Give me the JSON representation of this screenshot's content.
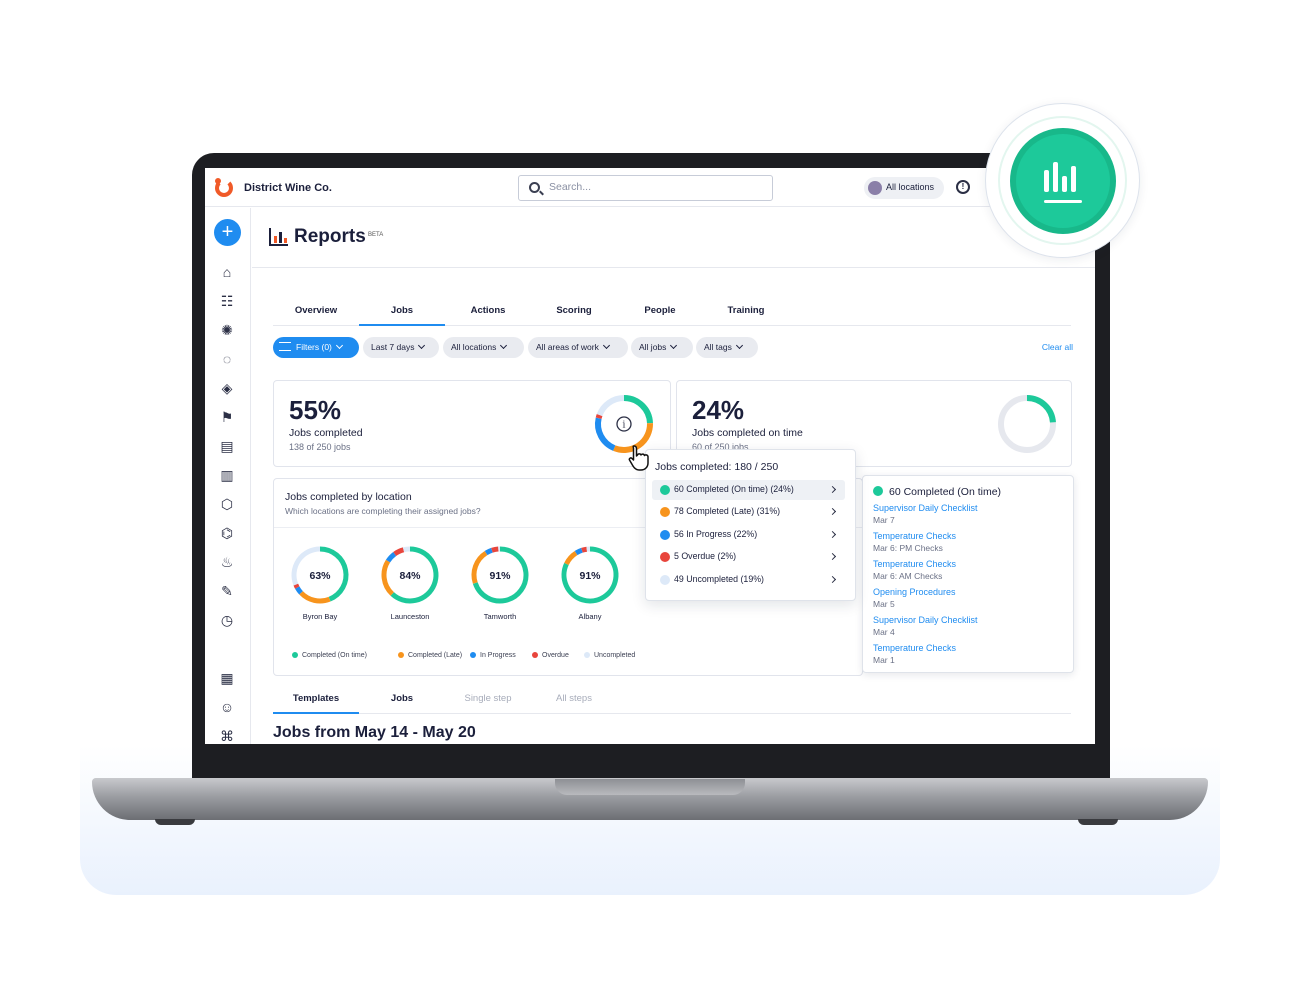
{
  "topbar": {
    "company": "District Wine Co.",
    "search_placeholder": "Search...",
    "locations_label": "All locations",
    "help_glyph": "!"
  },
  "sidebar": {
    "add_symbol": "+",
    "icons": [
      "home-icon",
      "checklist-icon",
      "lightbulb-icon",
      "chat-icon",
      "courses-icon",
      "flag-icon",
      "documents-icon",
      "assets-icon",
      "package-icon",
      "sensor-icon",
      "food-icon",
      "notes-icon",
      "timer-icon",
      "calendar-icon",
      "users-icon",
      "graduation-icon"
    ]
  },
  "page": {
    "title": "Reports",
    "badge": "BETA"
  },
  "tabs": [
    {
      "label": "Overview",
      "active": false
    },
    {
      "label": "Jobs",
      "active": true
    },
    {
      "label": "Actions",
      "active": false
    },
    {
      "label": "Scoring",
      "active": false
    },
    {
      "label": "People",
      "active": false
    },
    {
      "label": "Training",
      "active": false
    }
  ],
  "filters": {
    "chips": [
      "Filters (0)",
      "Last 7 days",
      "All locations",
      "All areas of work",
      "All jobs",
      "All tags"
    ],
    "clear_all": "Clear all"
  },
  "colors": {
    "on_time": "#1dc99a",
    "late": "#f7941d",
    "in_progress": "#1f8cf0",
    "overdue": "#e8453c",
    "uncompleted": "#dde9f8",
    "track": "#e6e8ee"
  },
  "kpi_completed": {
    "percent": "55%",
    "label": "Jobs completed",
    "sub": "138 of 250 jobs",
    "info_glyph": "i",
    "segments": [
      24,
      31,
      22,
      2,
      19
    ]
  },
  "kpi_on_time": {
    "percent": "24%",
    "label": "Jobs completed on time",
    "sub": "60 of 250 jobs",
    "fill": 0.24
  },
  "by_location": {
    "title": "Jobs completed by location",
    "subtitle": "Which locations are completing their assigned jobs?",
    "locations": [
      {
        "name": "Byron Bay",
        "percent": "63%",
        "segments": [
          44,
          19,
          4,
          2,
          31
        ]
      },
      {
        "name": "Launceston",
        "percent": "84%",
        "segments": [
          62,
          22,
          6,
          6,
          4
        ]
      },
      {
        "name": "Tamworth",
        "percent": "91%",
        "segments": [
          70,
          21,
          4,
          4,
          1
        ]
      },
      {
        "name": "Albany",
        "percent": "91%",
        "segments": [
          82,
          9,
          4,
          3,
          2
        ]
      }
    ],
    "legend": [
      "Completed (On time)",
      "Completed (Late)",
      "In Progress",
      "Overdue",
      "Uncompleted"
    ]
  },
  "tooltip": {
    "title": "Jobs completed: 180 / 250",
    "rows": [
      {
        "label": "60 Completed (On time) (24%)",
        "color": "#1dc99a"
      },
      {
        "label": "78 Completed (Late) (31%)",
        "color": "#f7941d"
      },
      {
        "label": "56 In Progress (22%)",
        "color": "#1f8cf0"
      },
      {
        "label": "5 Overdue (2%)",
        "color": "#e8453c"
      },
      {
        "label": "49 Uncompleted (19%)",
        "color": "#dde9f8"
      }
    ]
  },
  "detail_panel": {
    "heading": "60 Completed (On time)",
    "items": [
      {
        "name": "Supervisor Daily Checklist",
        "date": "Mar 7"
      },
      {
        "name": "Temperature Checks",
        "date": "Mar 6: PM Checks"
      },
      {
        "name": "Temperature Checks",
        "date": "Mar 6: AM Checks"
      },
      {
        "name": "Opening Procedures",
        "date": "Mar 5"
      },
      {
        "name": "Supervisor Daily Checklist",
        "date": "Mar 4"
      },
      {
        "name": "Temperature Checks",
        "date": "Mar 1"
      }
    ]
  },
  "sub_tabs": [
    {
      "label": "Templates",
      "state": "active"
    },
    {
      "label": "Jobs",
      "state": "normal"
    },
    {
      "label": "Single step",
      "state": "dim"
    },
    {
      "label": "All steps",
      "state": "dim"
    }
  ],
  "jobs_heading": "Jobs from May 14 - May 20"
}
